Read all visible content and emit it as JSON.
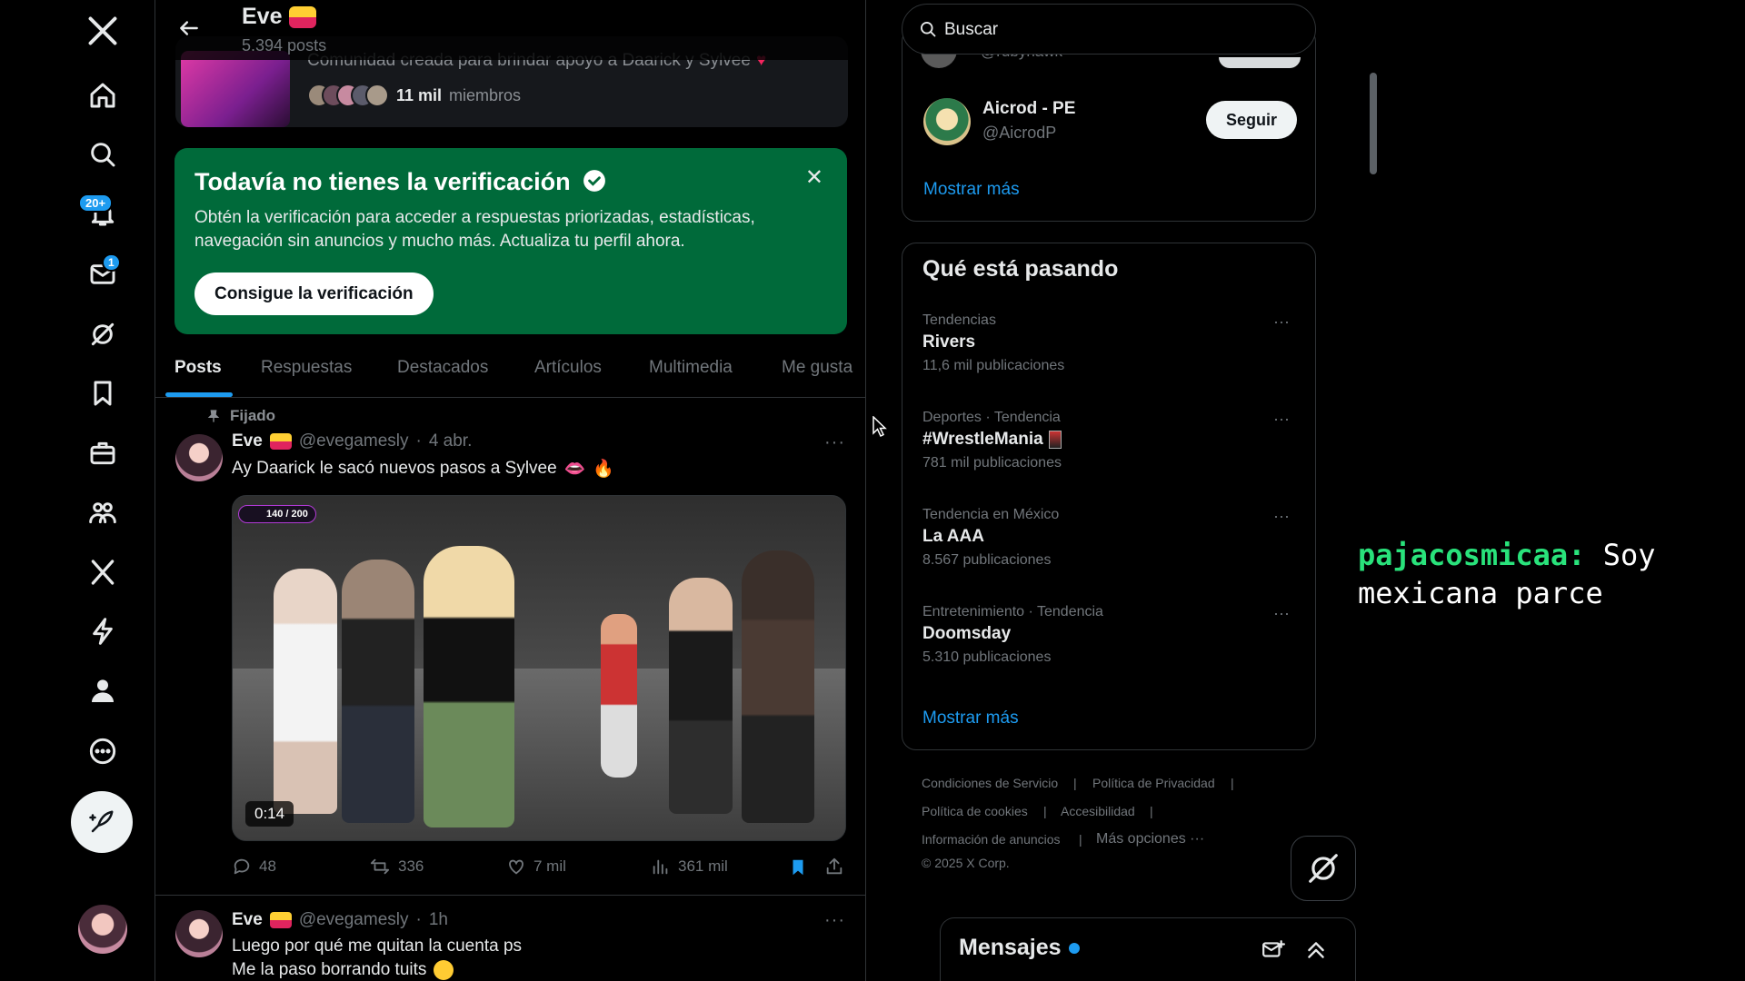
{
  "nav": {
    "notifications_badge": "20+",
    "messages_badge": "1"
  },
  "header": {
    "name": "Eve",
    "post_count": "5.394 posts"
  },
  "community": {
    "description": "Comunidad creada para brindar apoyo a Daarick y Sylvee",
    "members_count": "11 mil",
    "members_label": "miembros"
  },
  "verification": {
    "title": "Todavía no tienes la verificación",
    "text": "Obtén la verificación para acceder a respuestas priorizadas, estadísticas, navegación sin anuncios y mucho más. Actualiza tu perfil ahora.",
    "button": "Consigue la verificación"
  },
  "tabs": [
    "Posts",
    "Respuestas",
    "Destacados",
    "Artículos",
    "Multimedia",
    "Me gusta"
  ],
  "posts": [
    {
      "pinned_label": "Fijado",
      "name": "Eve",
      "handle": "@evegamesly",
      "time": "4 abr.",
      "text": "Ay Daarick le sacó nuevos pasos a Sylvee",
      "video_overlay": "140 / 200",
      "duration": "0:14",
      "replies": "48",
      "reposts": "336",
      "likes": "7 mil",
      "views": "361 mil"
    },
    {
      "name": "Eve",
      "handle": "@evegamesly",
      "time": "1h",
      "line1": "Luego por qué me quitan la cuenta ps",
      "line2": "Me la paso borrando tuits"
    }
  ],
  "right": {
    "search_placeholder": "Buscar",
    "who_to_follow": {
      "partial_handle": "@rubyhawk",
      "account_name": "Aicrod - PE",
      "account_handle": "@AicrodP",
      "follow_label": "Seguir",
      "show_more": "Mostrar más"
    },
    "trends": {
      "title": "Qué está pasando",
      "items": [
        {
          "category": "Tendencias",
          "name": "Rivers",
          "count": "11,6 mil publicaciones"
        },
        {
          "category": "Deportes · Tendencia",
          "name": "#WrestleMania",
          "count": "781 mil publicaciones"
        },
        {
          "category": "Tendencia en México",
          "name": "La AAA",
          "count": "8.567 publicaciones"
        },
        {
          "category": "Entretenimiento · Tendencia",
          "name": "Doomsday",
          "count": "5.310 publicaciones"
        }
      ],
      "show_more": "Mostrar más"
    },
    "footer": {
      "terms": "Condiciones de Servicio",
      "privacy": "Política de Privacidad",
      "cookies": "Política de cookies",
      "accessibility": "Accesibilidad",
      "ads_info": "Información de anuncios",
      "more": "Más opciones ···",
      "copyright": "© 2025 X Corp."
    }
  },
  "messages": {
    "title": "Mensajes"
  },
  "overlay_chat": {
    "user": "pajacosmicaa:",
    "message": "Soy mexicana parce"
  },
  "colors": {
    "accent": "#1d9bf0",
    "verify_bg": "#006a3a",
    "chat_user": "#29e27b"
  }
}
